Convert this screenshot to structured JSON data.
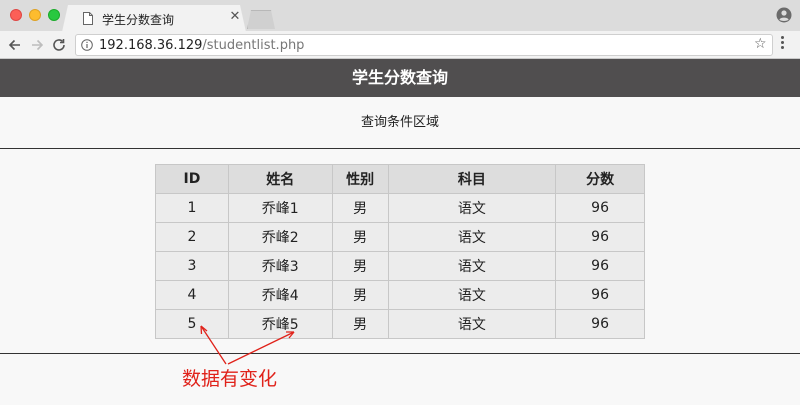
{
  "browser": {
    "tab_title": "学生分数查询",
    "url_host": "192.168.36.129",
    "url_path": "/studentlist.php"
  },
  "page": {
    "header_title": "学生分数查询",
    "query_area_label": "查询条件区域"
  },
  "table": {
    "columns": [
      "ID",
      "姓名",
      "性别",
      "科目",
      "分数"
    ],
    "rows": [
      [
        "1",
        "乔峰1",
        "男",
        "语文",
        "96"
      ],
      [
        "2",
        "乔峰2",
        "男",
        "语文",
        "96"
      ],
      [
        "3",
        "乔峰3",
        "男",
        "语文",
        "96"
      ],
      [
        "4",
        "乔峰4",
        "男",
        "语文",
        "96"
      ],
      [
        "5",
        "乔峰5",
        "男",
        "语文",
        "96"
      ]
    ]
  },
  "annotation": {
    "text": "数据有变化",
    "color": "#e0221a"
  },
  "colors": {
    "header_bg": "#504e4f",
    "table_header_bg": "#dddddd",
    "table_cell_bg": "#ececec"
  }
}
